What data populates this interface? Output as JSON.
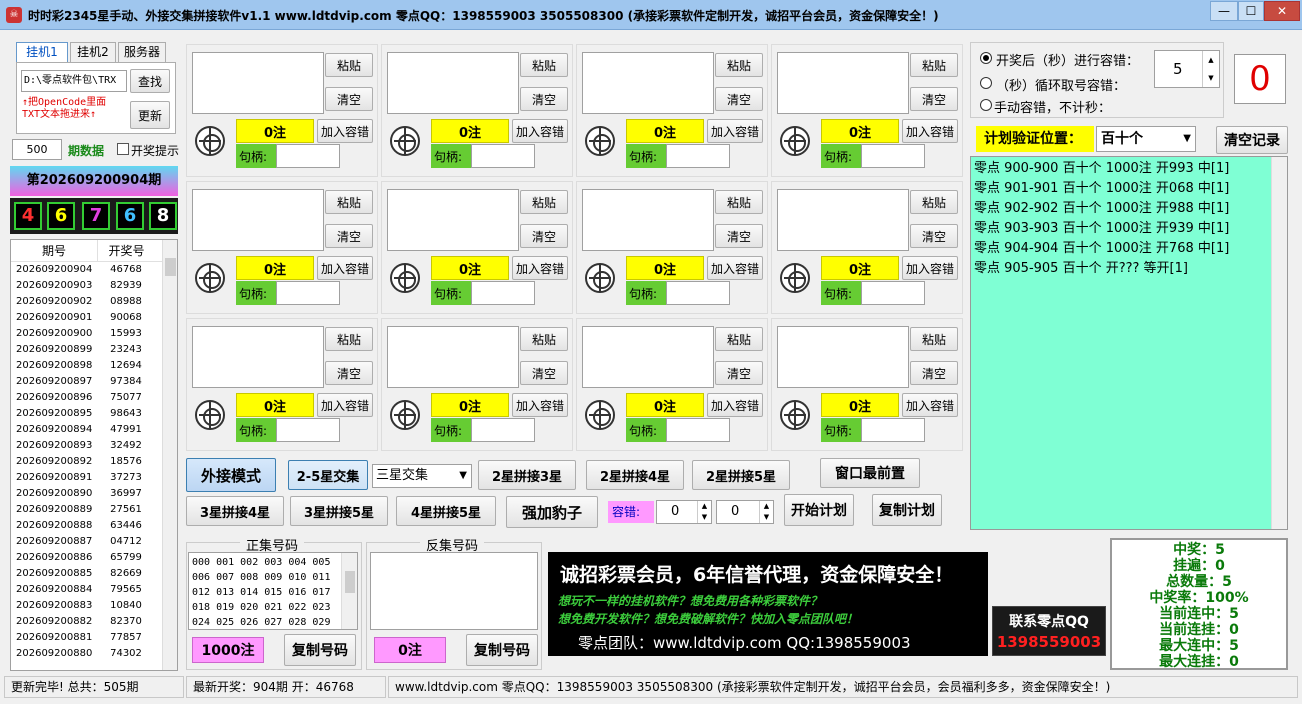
{
  "window": {
    "title": "时时彩2345星手动、外接交集拼接软件v1.1      www.ldtdvip.com      零点QQ：1398559003   3505508300      (承接彩票软件定制开发，诚招平台会员，资金保障安全！)",
    "min": "—",
    "max": "☐",
    "close": "✕"
  },
  "left": {
    "tabs": [
      "挂机1",
      "挂机2",
      "服务器"
    ],
    "path_value": "D:\\零点软件包\\TRX",
    "find_label": "查找",
    "update_label": "更新",
    "hint": "↑把OpenCode里面\nTXT文本拖进来↑",
    "period_count": "500",
    "period_label": "期数据",
    "notice_label": "开奖提示",
    "current_period": "第202609200904期",
    "balls": [
      "4",
      "6",
      "7",
      "6",
      "8"
    ],
    "ball_colors": [
      "#ff3030",
      "#ffff00",
      "#e040e0",
      "#40c0ff",
      "#ffffff"
    ],
    "list_headers": [
      "期号",
      "开奖号"
    ],
    "rows": [
      [
        "202609200904",
        "46768"
      ],
      [
        "202609200903",
        "82939"
      ],
      [
        "202609200902",
        "08988"
      ],
      [
        "202609200901",
        "90068"
      ],
      [
        "202609200900",
        "15993"
      ],
      [
        "202609200899",
        "23243"
      ],
      [
        "202609200898",
        "12694"
      ],
      [
        "202609200897",
        "97384"
      ],
      [
        "202609200896",
        "75077"
      ],
      [
        "202609200895",
        "98643"
      ],
      [
        "202609200894",
        "47991"
      ],
      [
        "202609200893",
        "32492"
      ],
      [
        "202609200892",
        "18576"
      ],
      [
        "202609200891",
        "37273"
      ],
      [
        "202609200890",
        "36997"
      ],
      [
        "202609200889",
        "27561"
      ],
      [
        "202609200888",
        "63446"
      ],
      [
        "202609200887",
        "04712"
      ],
      [
        "202609200886",
        "65799"
      ],
      [
        "202609200885",
        "82669"
      ],
      [
        "202609200884",
        "79565"
      ],
      [
        "202609200883",
        "10840"
      ],
      [
        "202609200882",
        "82370"
      ],
      [
        "202609200881",
        "77857"
      ],
      [
        "202609200880",
        "74302"
      ]
    ]
  },
  "grid": {
    "paste_label": "粘贴",
    "clear_label": "清空",
    "count_label": "0注",
    "add_label": "加入容错",
    "handle_label": "句柄:"
  },
  "toolbar": {
    "external_mode": "外接模式",
    "cross_25": "2-5星交集",
    "select_value": "三星交集",
    "r1": [
      "2星拼接3星",
      "2星拼接4星",
      "2星拼接5星",
      "窗口最前置"
    ],
    "r2": [
      "3星拼接4星",
      "3星拼接5星",
      "4星拼接5星",
      "强加豹子"
    ],
    "tolerance_label": "容错:",
    "tol1": "0",
    "tol2": "0",
    "start_plan": "开始计划",
    "copy_plan": "复制计划"
  },
  "codes": {
    "pos_title": "正集号码",
    "neg_title": "反集号码",
    "pos_text": "000 001 002 003 004 005\n006 007 008 009 010 011\n012 013 014 015 016 017\n018 019 020 021 022 023\n024 025 026 027 028 029",
    "pos_count": "1000注",
    "neg_count": "0注",
    "copy_label": "复制号码"
  },
  "banner": {
    "line1": "诚招彩票会员，6年信誉代理，资金保障安全！",
    "line2": "想玩不一样的挂机软件？想免费用各种彩票软件？",
    "line3": "想免费开发软件？想免费破解软件？快加入零点团队吧！",
    "line4": "零点团队：www.ldtdvip.com  QQ:1398559003",
    "qq_title": "联系零点QQ",
    "qq_number": "1398559003"
  },
  "right": {
    "opt1": "开奖后（秒）进行容错：",
    "opt2": "（秒）循环取号容错：",
    "opt3": "手动容错，不计秒：",
    "seconds": "5",
    "counter": "0",
    "plan_pos_label": "计划验证位置：",
    "plan_pos_value": "百十个",
    "clear_records": "清空记录",
    "log": [
      "零点 900-900 百十个 1000注 开993 中[1]",
      "零点 901-901 百十个 1000注 开068 中[1]",
      "零点 902-902 百十个 1000注 开988 中[1]",
      "零点 903-903 百十个 1000注 开939 中[1]",
      "零点 904-904 百十个 1000注 开768 中[1]",
      "零点 905-905 百十个 开???  等开[1]"
    ],
    "stats": [
      "中奖：5",
      "挂遍：0",
      "总数量：5",
      "中奖率：100%",
      "当前连中：5",
      "当前连挂：0",
      "最大连中：5",
      "最大连挂：0"
    ]
  },
  "statusbar": {
    "s1": "更新完毕! 总共：505期",
    "s2": "最新开奖：904期 开：46768",
    "s3": "www.ldtdvip.com   零点QQ：1398559003  3505508300   (承接彩票软件定制开发，诚招平台会员，会员福利多多，资金保障安全！)"
  }
}
